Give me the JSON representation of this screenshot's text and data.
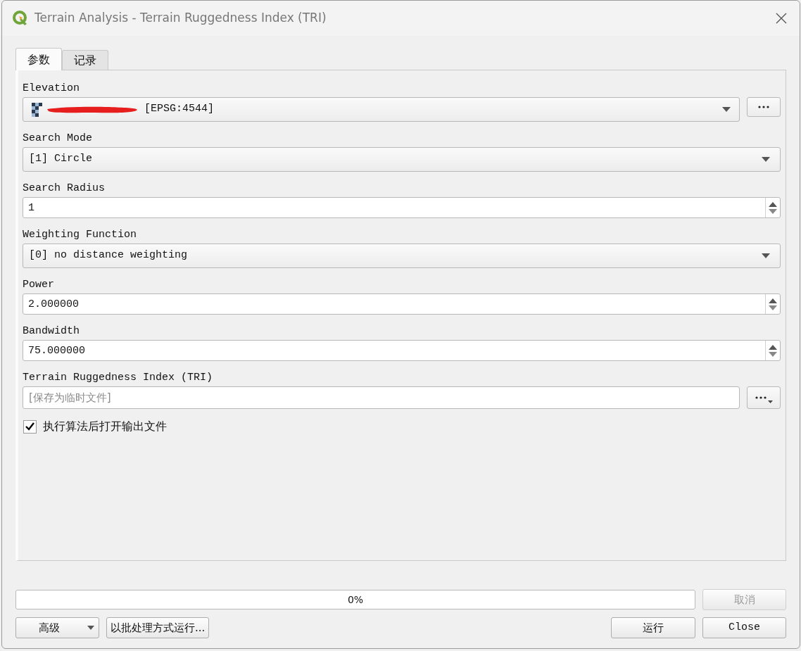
{
  "window": {
    "title": "Terrain Analysis - Terrain Ruggedness Index (TRI)"
  },
  "tabs": [
    {
      "label": "参数",
      "selected": true
    },
    {
      "label": "记录",
      "selected": false
    }
  ],
  "parameters": [
    {
      "kind": "layer",
      "label": "Elevation",
      "value": "[EPSG:4544]"
    },
    {
      "kind": "combo",
      "label": "Search Mode",
      "value": "[1] Circle"
    },
    {
      "kind": "spin",
      "label": "Search Radius",
      "value": "1"
    },
    {
      "kind": "combo",
      "label": "Weighting Function",
      "value": "[0] no distance weighting"
    },
    {
      "kind": "spin",
      "label": "Power",
      "value": "2.000000"
    },
    {
      "kind": "spin",
      "label": "Bandwidth",
      "value": "75.000000"
    },
    {
      "kind": "file",
      "label": "Terrain Ruggedness Index (TRI)",
      "placeholder": "[保存为临时文件]"
    }
  ],
  "open_output": {
    "label": "执行算法后打开输出文件",
    "checked": true
  },
  "progress": {
    "level": 0,
    "reading": "0%"
  },
  "cancel_button": {
    "label": "取消",
    "disabled": true
  },
  "advanced_button": {
    "label": "高级"
  },
  "batch_button": {
    "label": "以批处理方式运行..."
  },
  "run_button": {
    "label": "运行"
  },
  "close_button": {
    "label": "Close"
  }
}
